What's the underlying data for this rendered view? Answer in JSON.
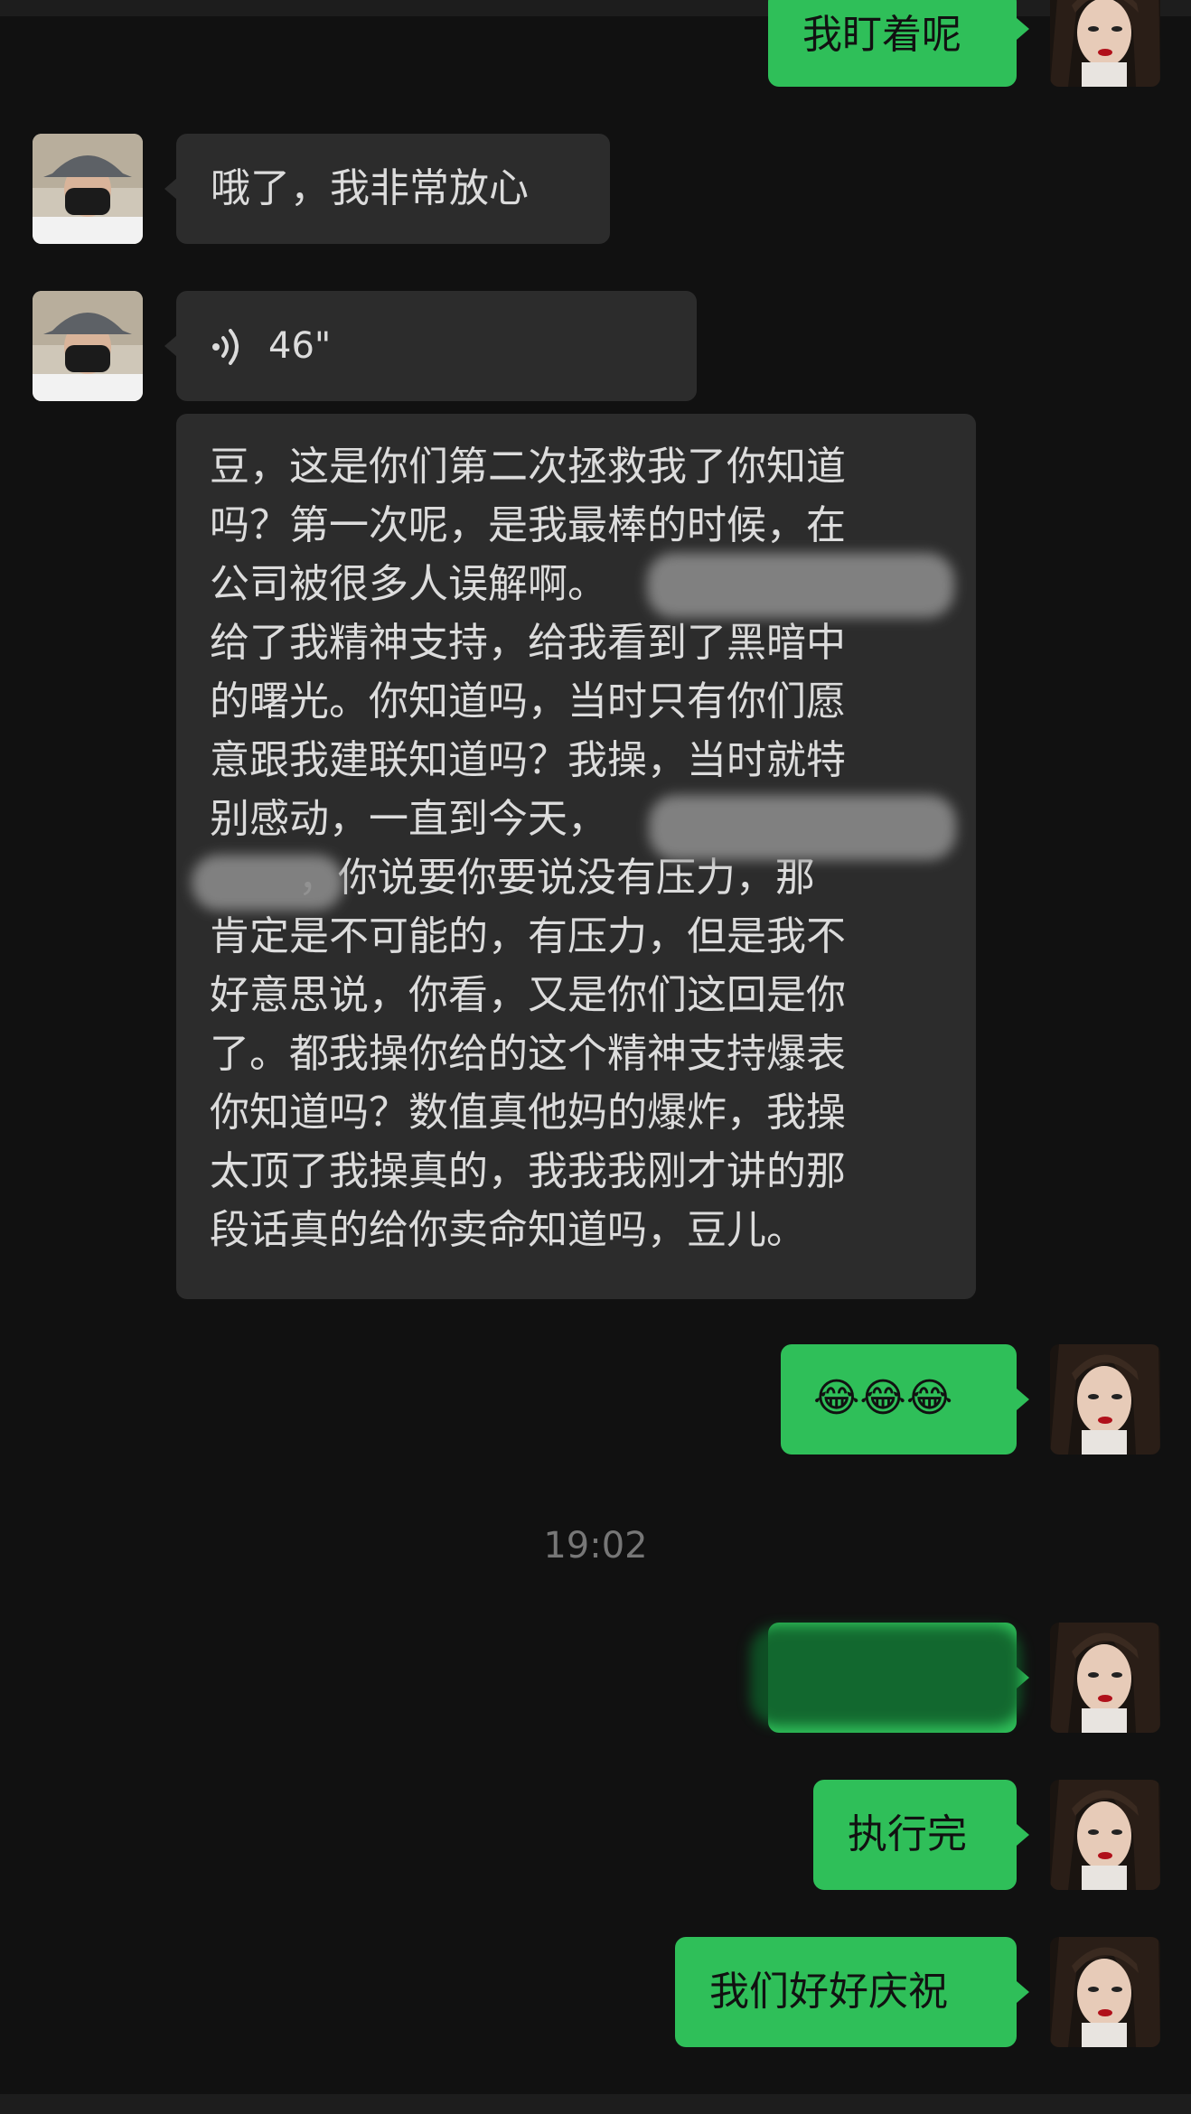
{
  "messages": {
    "m1_text": "我盯着呢",
    "m2_text": "哦了，我非常放心",
    "m3_voice_duration": "46\"",
    "m3_transcript": "豆，这是你们第二次拯救我了你知道\n吗？第一次呢，是我最棒的时候，在\n公司被很多人误解啊。\n给了我精神支持，给我看到了黑暗中\n的曙光。你知道吗，当时只有你们愿\n意跟我建联知道吗？我操，当时就特\n别感动，一直到今天，\n       ，你说要你要说没有压力，那\n肯定是不可能的，有压力，但是我不\n好意思说，你看，又是你们这回是你\n了。都我操你给的这个精神支持爆表\n你知道吗？数值真他妈的爆炸，我操\n太顶了我操真的，我我我刚才讲的那\n段话真的给你卖命知道吗，豆儿。",
    "m4_text": "😂😂😂",
    "timestamp": "19:02",
    "m6_text": "执行完",
    "m7_text": "我们好好庆祝"
  },
  "icons": {
    "voice": "voice-wave-icon",
    "contact_avatar": "bucket-hat-masked-avatar",
    "self_avatar": "long-hair-woman-avatar"
  },
  "colors": {
    "background": "#111111",
    "incoming_bubble": "#2c2c2c",
    "outgoing_bubble": "#2fbf59",
    "timestamp": "#777777"
  }
}
